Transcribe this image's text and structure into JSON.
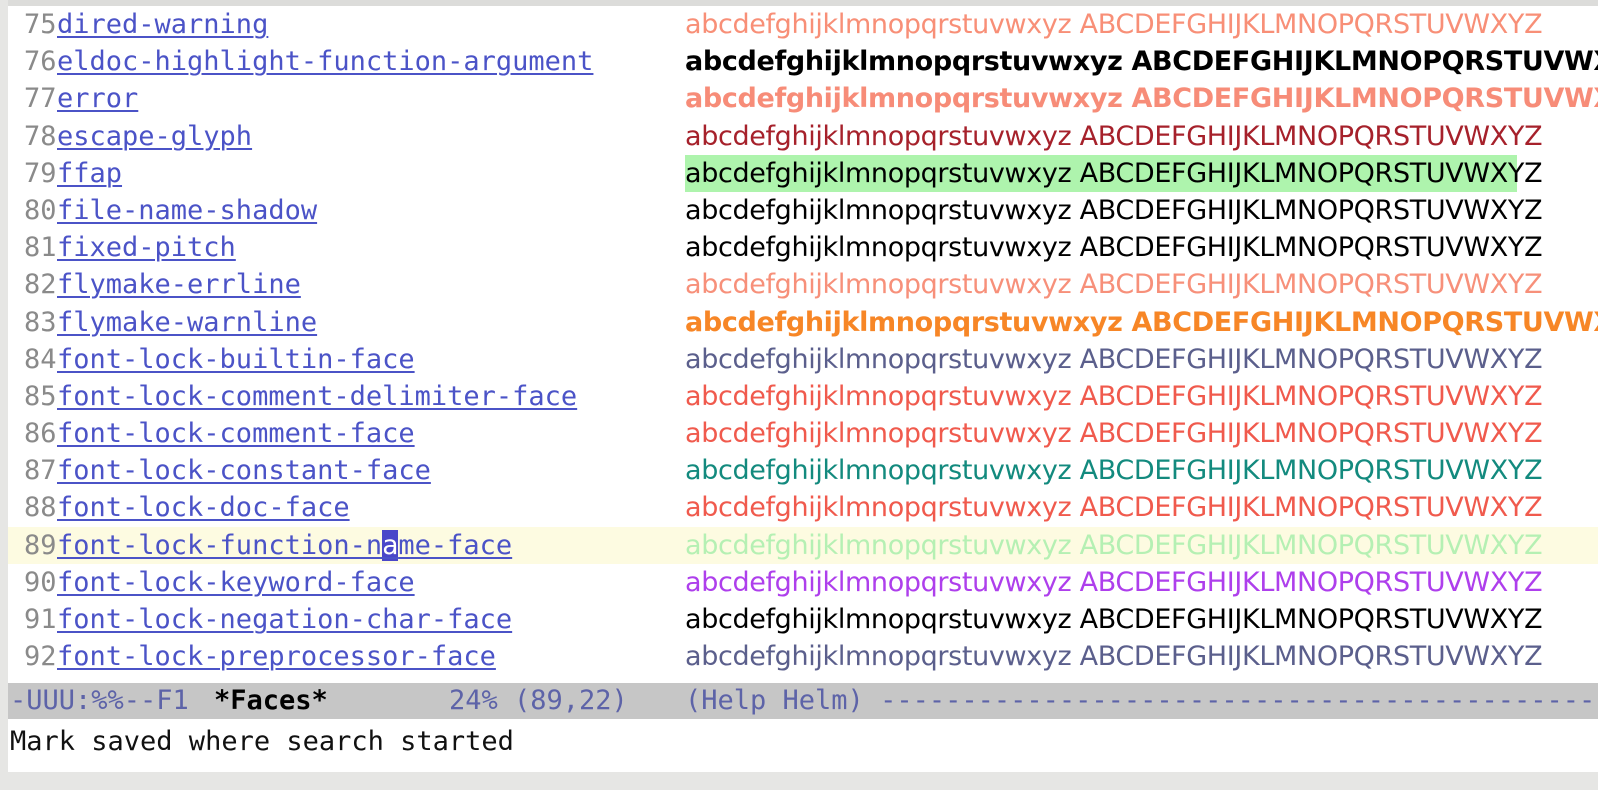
{
  "buffer": {
    "sample_text": "abcdefghijklmnopqrstuvwxyz ABCDEFGHIJKLMNOPQRSTUVWXYZ",
    "current_line": 89,
    "lines": [
      {
        "num": "75",
        "name": "dired-warning",
        "color": "#f88f77",
        "weight": "normal",
        "bg": ""
      },
      {
        "num": "76",
        "name": "eldoc-highlight-function-argument",
        "color": "#000000",
        "weight": "bold",
        "bg": ""
      },
      {
        "num": "77",
        "name": "error",
        "color": "#f78c78",
        "weight": "bold",
        "bg": ""
      },
      {
        "num": "78",
        "name": "escape-glyph",
        "color": "#a6212b",
        "weight": "normal",
        "bg": ""
      },
      {
        "num": "79",
        "name": "ffap",
        "color": "#000000",
        "weight": "normal",
        "bg": "#aef4ad"
      },
      {
        "num": "80",
        "name": "file-name-shadow",
        "color": "#000000",
        "weight": "normal",
        "bg": ""
      },
      {
        "num": "81",
        "name": "fixed-pitch",
        "color": "#000000",
        "weight": "normal",
        "bg": ""
      },
      {
        "num": "82",
        "name": "flymake-errline",
        "color": "#f7907a",
        "weight": "normal",
        "bg": ""
      },
      {
        "num": "83",
        "name": "flymake-warnline",
        "color": "#f78626",
        "weight": "bold",
        "bg": ""
      },
      {
        "num": "84",
        "name": "font-lock-builtin-face",
        "color": "#5b5f8c",
        "weight": "normal",
        "bg": ""
      },
      {
        "num": "85",
        "name": "font-lock-comment-delimiter-face",
        "color": "#f05a4d",
        "weight": "normal",
        "bg": ""
      },
      {
        "num": "86",
        "name": "font-lock-comment-face",
        "color": "#f05a4d",
        "weight": "normal",
        "bg": ""
      },
      {
        "num": "87",
        "name": "font-lock-constant-face",
        "color": "#138a7e",
        "weight": "normal",
        "bg": ""
      },
      {
        "num": "88",
        "name": "font-lock-doc-face",
        "color": "#f05a4d",
        "weight": "normal",
        "bg": ""
      },
      {
        "num": "89",
        "name": "font-lock-function-name-face",
        "color": "#b5f0b3",
        "weight": "normal",
        "bg": ""
      },
      {
        "num": "90",
        "name": "font-lock-keyword-face",
        "color": "#ae3fec",
        "weight": "normal",
        "bg": ""
      },
      {
        "num": "91",
        "name": "font-lock-negation-char-face",
        "color": "#000000",
        "weight": "normal",
        "bg": ""
      },
      {
        "num": "92",
        "name": "font-lock-preprocessor-face",
        "color": "#5b5f8c",
        "weight": "normal",
        "bg": ""
      }
    ]
  },
  "cursor": {
    "line": 89,
    "column": 22
  },
  "modeline": {
    "status": "-UUU:%%--F1",
    "buffer_name": "*Faces*",
    "position": "24% (89,22)",
    "modes": "(Help Helm) ---------------------------------------------------------------------"
  },
  "echo_area": {
    "message": "Mark saved where search started"
  }
}
